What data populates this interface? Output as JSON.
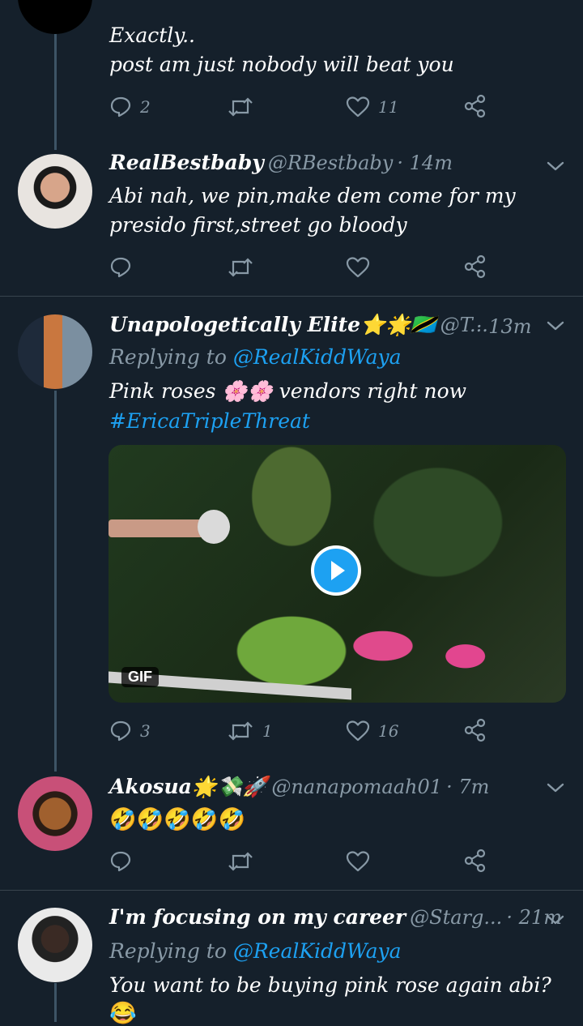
{
  "tweets": [
    {
      "text_lines": [
        "Exactly..",
        "post am just nobody will beat you"
      ],
      "replies": "2",
      "retweets": "",
      "likes": "11"
    },
    {
      "name": "RealBestbaby",
      "handle": "@RBestbaby",
      "time": "· 14m",
      "text_lines": [
        "Abi nah, we pin,make dem come for my",
        "presido first,street go bloody"
      ],
      "replies": "",
      "retweets": "",
      "likes": ""
    },
    {
      "name": "Unapologetically Elite⭐🌟🇹🇿",
      "handle": "@T...",
      "time": "· 13m",
      "replying_prefix": "Replying to",
      "replying_to": "@RealKiddWaya",
      "text_lines": [
        "Pink roses 🌸🌸 vendors right now"
      ],
      "hashtag": "#EricaTripleThreat",
      "media_badge": "GIF",
      "replies": "3",
      "retweets": "1",
      "likes": "16"
    },
    {
      "name": "Akosua🌟💸🚀",
      "handle": "@nanapomaah01",
      "time": "· 7m",
      "emoji_text": "🤣🤣🤣🤣🤣",
      "replies": "",
      "retweets": "",
      "likes": ""
    },
    {
      "name": "I'm focusing on my career",
      "handle": "@Starg...",
      "time": "· 21m",
      "replying_prefix": "Replying to",
      "replying_to": "@RealKiddWaya",
      "text_lines": [
        "You want to be buying pink rose again abi?"
      ],
      "emoji_text": "😂"
    }
  ],
  "colors": {
    "background": "#15202b",
    "secondary_text": "#8899a6",
    "accent": "#1da1f2",
    "separator": "#38444d"
  },
  "icons": [
    "reply-icon",
    "retweet-icon",
    "like-icon",
    "share-icon",
    "chevron-down-icon",
    "play-icon"
  ]
}
